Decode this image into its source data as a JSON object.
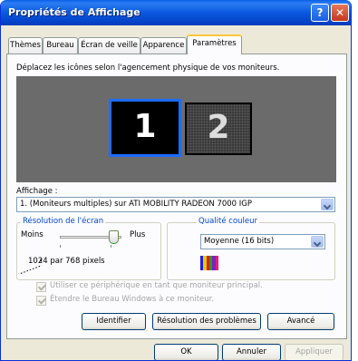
{
  "window": {
    "title": "Propriétés de Affichage"
  },
  "titlebar": {
    "help_symbol": "?",
    "close_symbol": "✕"
  },
  "tabs": [
    {
      "label": "Thèmes"
    },
    {
      "label": "Bureau"
    },
    {
      "label": "Écran de veille"
    },
    {
      "label": "Apparence"
    },
    {
      "label": "Paramètres",
      "active": true
    }
  ],
  "settings": {
    "instruction": "Déplacez les icônes selon l'agencement physique de vos moniteurs.",
    "monitors": [
      {
        "number": "1",
        "selected": true
      },
      {
        "number": "2",
        "selected": false
      }
    ],
    "display_label": "Affichage :",
    "display_value": "1. (Moniteurs multiples) sur ATI MOBILITY RADEON 7000 IGP",
    "resolution": {
      "legend": "Résolution de l'écran",
      "less": "Moins",
      "more": "Plus",
      "value_text": "1024 par 768 pixels"
    },
    "color_quality": {
      "legend": "Qualité couleur",
      "selected": "Moyenne (16 bits)"
    },
    "checkbox_primary": "Utiliser ce périphérique en tant que moniteur principal.",
    "checkbox_extend": "Étendre le Bureau Windows à ce moniteur."
  },
  "buttons": {
    "identify": "Identifier",
    "troubleshoot": "Résolution des problèmes",
    "advanced": "Avancé",
    "ok": "OK",
    "cancel": "Annuler",
    "apply": "Appliquer"
  },
  "colors": {
    "title_bar": "#0a5fe8",
    "group_legend": "#0046d5",
    "monitor_selection": "#1e6bff"
  }
}
